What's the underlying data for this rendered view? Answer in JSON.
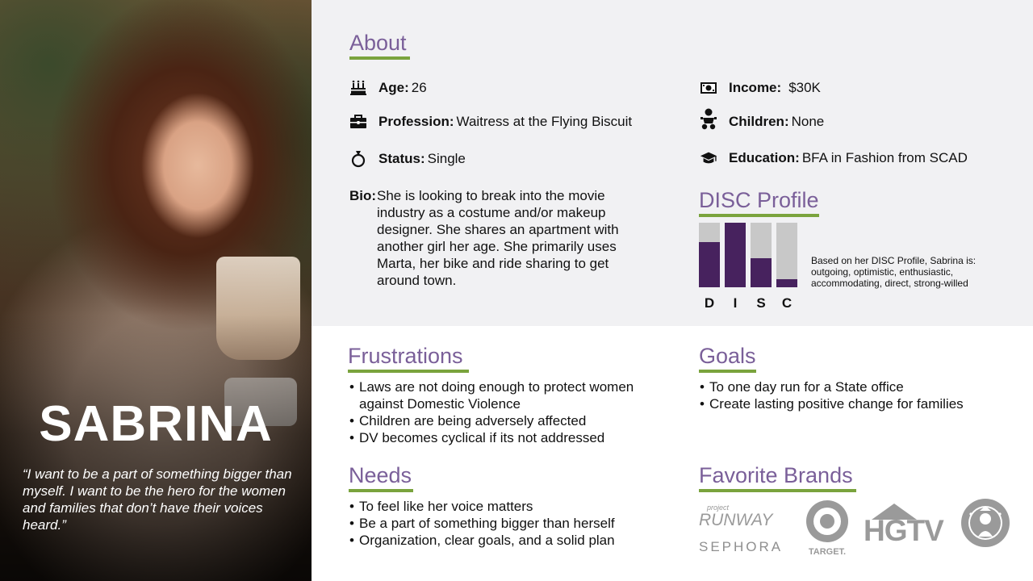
{
  "persona": {
    "name": "SABRINA",
    "quote": "“I want to be a part of something bigger than myself. I want to be the hero for the women and families that don’t have their voices heard.”"
  },
  "about": {
    "heading": "About",
    "age": {
      "label": "Age:",
      "value": "26",
      "icon": "birthday-cake-icon"
    },
    "profession": {
      "label": "Profession:",
      "value": "Waitress at the Flying Biscuit",
      "icon": "briefcase-icon"
    },
    "status": {
      "label": "Status:",
      "value": "Single",
      "icon": "ring-icon"
    },
    "income": {
      "label": "Income:",
      "value": "$30K",
      "icon": "money-icon"
    },
    "children": {
      "label": "Children:",
      "value": "None",
      "icon": "child-icon"
    },
    "education": {
      "label": "Education:",
      "value": "BFA in Fashion from SCAD",
      "icon": "graduation-cap-icon"
    },
    "bio": {
      "label": "Bio:",
      "value": "She is looking to break into the movie industry as a costume and/or makeup designer. She shares an apartment with another girl her age. She primarily uses Marta, her bike and ride sharing to get around town."
    }
  },
  "disc": {
    "heading": "DISC Profile",
    "description": "Based on her DISC Profile, Sabrina is: outgoing, optimistic, enthusiastic, accommodating, direct, strong-willed",
    "colors": {
      "fill": "#47225e",
      "track": "#c8c8c8"
    }
  },
  "chart_data": {
    "type": "bar",
    "categories": [
      "D",
      "I",
      "S",
      "C"
    ],
    "values": [
      0.7,
      1.0,
      0.45,
      0.12
    ],
    "ylim": [
      0,
      1
    ]
  },
  "frustrations": {
    "heading": "Frustrations",
    "items": [
      "Laws are not doing enough to protect women against Domestic Violence",
      "Children are being adversely affected",
      "DV becomes cyclical if its not addressed"
    ]
  },
  "goals": {
    "heading": "Goals",
    "items": [
      "To one day run for a State office",
      "Create lasting positive change for families"
    ]
  },
  "needs": {
    "heading": "Needs",
    "items": [
      "To feel like her voice matters",
      "Be a part of something bigger than herself",
      "Organization, clear goals, and a solid plan"
    ]
  },
  "brands": {
    "heading": "Favorite Brands",
    "runway_small": "project",
    "runway": "RUNWAY",
    "sephora": "SEPHORA",
    "target": "TARGET.",
    "hgtv": "HGTV"
  },
  "colors": {
    "accent": "#7a5f99",
    "underline": "#7aa33d",
    "panel": "#f1f1f3"
  }
}
